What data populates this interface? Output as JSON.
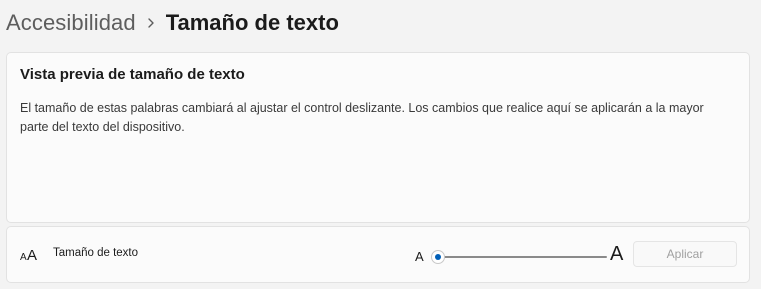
{
  "breadcrumb": {
    "parent": "Accesibilidad",
    "current": "Tamaño de texto"
  },
  "preview": {
    "title": "Vista previa de tamaño de texto",
    "text": "El tamaño de estas palabras cambiará al ajustar el control deslizante. Los cambios que realice aquí se aplicarán a la mayor parte del texto del dispositivo."
  },
  "setting": {
    "icon": "text-size-icon",
    "label": "Tamaño de texto",
    "slider": {
      "min_label": "A",
      "max_label": "A",
      "value_fraction": 0.0,
      "accent_color": "#005fb8"
    },
    "apply_label": "Aplicar",
    "apply_enabled": false
  }
}
